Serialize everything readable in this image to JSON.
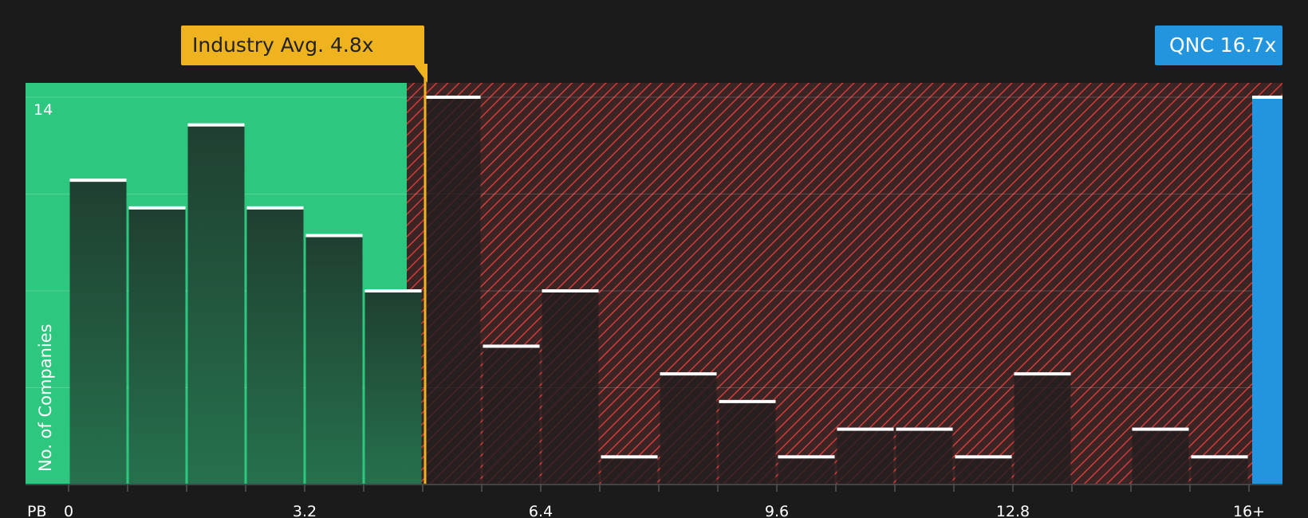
{
  "chart_data": {
    "type": "bar",
    "metric_label": "PB",
    "ylabel": "No. of Companies",
    "ytick_label": "14",
    "ymax": 14,
    "x_ticks": [
      "0",
      "3.2",
      "6.4",
      "9.6",
      "12.8",
      "16+"
    ],
    "x_tick_values": [
      0,
      3.2,
      6.4,
      9.6,
      12.8,
      16
    ],
    "bin_width": 0.8,
    "bins": [
      {
        "x0": 0.0,
        "value": 11
      },
      {
        "x0": 0.8,
        "value": 10
      },
      {
        "x0": 1.6,
        "value": 13
      },
      {
        "x0": 2.4,
        "value": 10
      },
      {
        "x0": 3.2,
        "value": 9
      },
      {
        "x0": 4.0,
        "value": 7
      },
      {
        "x0": 4.8,
        "value": 14
      },
      {
        "x0": 5.6,
        "value": 5
      },
      {
        "x0": 6.4,
        "value": 7
      },
      {
        "x0": 7.2,
        "value": 1
      },
      {
        "x0": 8.0,
        "value": 4
      },
      {
        "x0": 8.8,
        "value": 3
      },
      {
        "x0": 9.6,
        "value": 1
      },
      {
        "x0": 10.4,
        "value": 2
      },
      {
        "x0": 11.2,
        "value": 2
      },
      {
        "x0": 12.0,
        "value": 1
      },
      {
        "x0": 12.8,
        "value": 4
      },
      {
        "x0": 13.6,
        "value": 0
      },
      {
        "x0": 14.4,
        "value": 2
      },
      {
        "x0": 15.2,
        "value": 1
      }
    ],
    "company_bar": {
      "value": 14
    },
    "industry_avg": {
      "value": 4.8,
      "label": "Industry Avg. 4.8x"
    },
    "company": {
      "value": 16.7,
      "label": "QNC 16.7x"
    },
    "grid": true,
    "colors": {
      "background": "#1b1b1b",
      "undervalued_zone": "#2ec77f",
      "overvalued_zone": "#3a2424",
      "hatch": "#d23c3c",
      "bar_green": "#1e4a37",
      "bar_red": "#2a2424",
      "bar_cap": "#ffffff",
      "industry": "#efb320",
      "company": "#2394de"
    }
  }
}
